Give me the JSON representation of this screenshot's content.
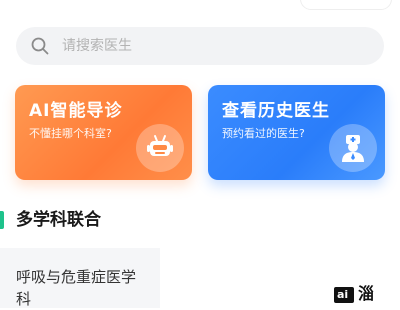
{
  "search": {
    "placeholder": "请搜索医生",
    "icon": "search-icon"
  },
  "cards": {
    "ai": {
      "title": "AI智能导诊",
      "subtitle": "不懂挂哪个科室?",
      "icon": "robot-icon",
      "color_from": "#ff9a52",
      "color_to": "#ff7a36"
    },
    "history": {
      "title": "查看历史医生",
      "subtitle": "预约看过的医生?",
      "icon": "doctor-icon",
      "color_from": "#3b8cff",
      "color_to": "#2a7dfa"
    }
  },
  "section": {
    "title": "多学科联合",
    "accent": "#1ec28b"
  },
  "departments": [
    {
      "label": "呼吸与危重症医学科"
    }
  ],
  "logo": {
    "box": "ai",
    "text": "淄"
  }
}
